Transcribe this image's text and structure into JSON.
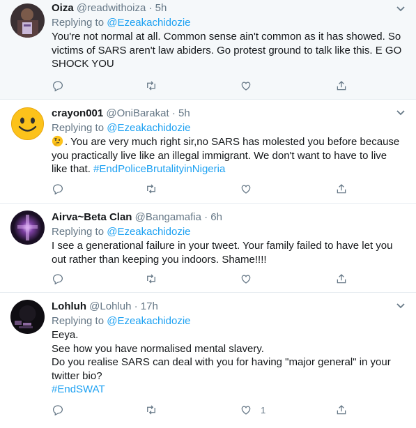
{
  "tweets": [
    {
      "name": "Oiza",
      "handle": "@readwithoiza",
      "time": "5h",
      "replying_prefix": "Replying to",
      "replying_to": "@Ezeakachidozie",
      "lines": [
        "You're not normal at all. Common sense ain't common as it has showed. So",
        "victims of SARS aren't law abiders. Go protest ground to talk like this. E GO",
        "SHOCK YOU"
      ],
      "like_count": "",
      "avatar": "book-photo-avatar"
    },
    {
      "name": "crayon001",
      "handle": "@OniBarakat",
      "time": "5h",
      "replying_prefix": "Replying to",
      "replying_to": "@Ezeakachidozie",
      "lines": [
        ". You are very much right sir,no SARS has molested you before because",
        "you practically live like an illegal immigrant. We don't want to have to live",
        "like that."
      ],
      "hashtag": "#EndPoliceBrutalityinNigeria",
      "like_count": "",
      "avatar": "smiley-emoji-avatar"
    },
    {
      "name": "Airva~Beta Clan",
      "handle": "@Bangamafia",
      "time": "6h",
      "replying_prefix": "Replying to",
      "replying_to": "@Ezeakachidozie",
      "lines": [
        "I see a generational failure in your tweet. Your family failed to have let you",
        "out rather than keeping you indoors. Shame!!!!"
      ],
      "like_count": "",
      "avatar": "purple-glow-avatar"
    },
    {
      "name": "Lohluh",
      "handle": "@Lohluh",
      "time": "17h",
      "replying_prefix": "Replying to",
      "replying_to": "@Ezeakachidozie",
      "lines": [
        "Eeya.",
        "See how you have normalised mental slavery.",
        "Do you realise SARS can deal with you for having \"major general\" in your",
        "twitter bio?"
      ],
      "hashtag": "#EndSWAT",
      "like_count": "1",
      "avatar": "dark-photo-avatar"
    }
  ],
  "colors": {
    "link": "#1da1f2",
    "muted": "#657786",
    "text": "#14171a",
    "highlight_bg": "#f5f8fa",
    "divider": "#e6ecf0"
  },
  "icons": [
    "reply-icon",
    "retweet-icon",
    "like-icon",
    "share-icon",
    "chevron-down-icon",
    "thinking-emoji"
  ]
}
